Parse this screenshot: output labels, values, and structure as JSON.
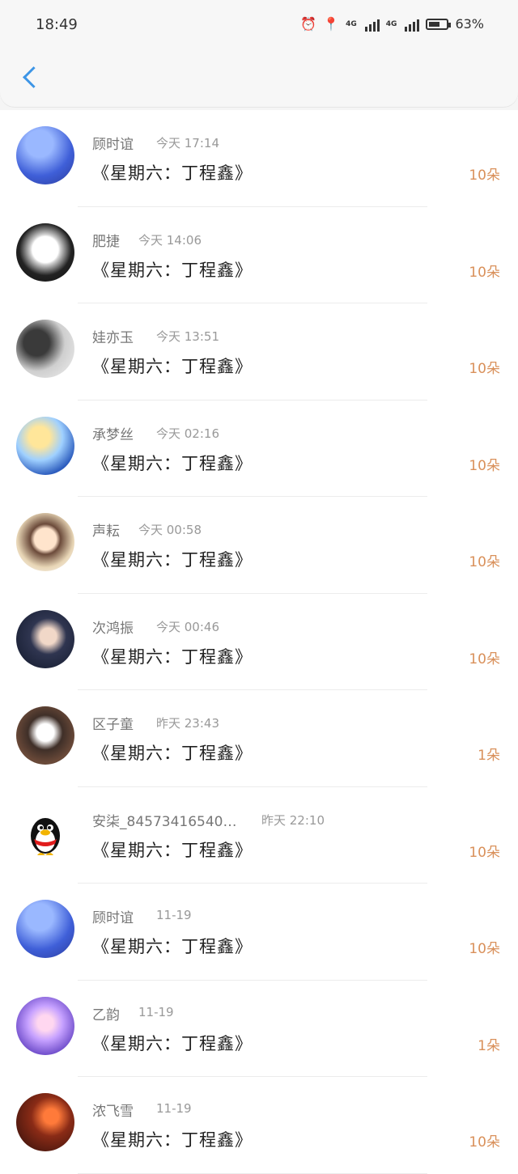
{
  "status": {
    "time": "18:49",
    "battery": "63%",
    "battery_level": 0.63,
    "net1": "4G",
    "net2": "4G"
  },
  "nav": {
    "back_icon": "chevron-left-icon"
  },
  "items": [
    {
      "name": "顾时谊",
      "time": "今天 17:14",
      "title": "《星期六：丁程鑫》",
      "count": "10朵",
      "avatar": "avatar-1"
    },
    {
      "name": "肥捷",
      "time": "今天 14:06",
      "title": "《星期六：丁程鑫》",
      "count": "10朵",
      "avatar": "avatar-2"
    },
    {
      "name": "娃亦玉",
      "time": "今天 13:51",
      "title": "《星期六：丁程鑫》",
      "count": "10朵",
      "avatar": "avatar-3"
    },
    {
      "name": "承梦丝",
      "time": "今天 02:16",
      "title": "《星期六：丁程鑫》",
      "count": "10朵",
      "avatar": "avatar-4"
    },
    {
      "name": "声耘",
      "time": "今天 00:58",
      "title": "《星期六：丁程鑫》",
      "count": "10朵",
      "avatar": "avatar-5"
    },
    {
      "name": "次鸿振",
      "time": "今天 00:46",
      "title": "《星期六：丁程鑫》",
      "count": "10朵",
      "avatar": "avatar-6"
    },
    {
      "name": "区子童",
      "time": "昨天 23:43",
      "title": "《星期六：丁程鑫》",
      "count": "1朵",
      "avatar": "avatar-7"
    },
    {
      "name": "安柒_84573416540…",
      "time": "昨天 22:10",
      "title": "《星期六：丁程鑫》",
      "count": "10朵",
      "avatar": "qq-penguin-avatar"
    },
    {
      "name": "顾时谊",
      "time": "11-19",
      "title": "《星期六：丁程鑫》",
      "count": "10朵",
      "avatar": "avatar-1"
    },
    {
      "name": "乙韵",
      "time": "11-19",
      "title": "《星期六：丁程鑫》",
      "count": "1朵",
      "avatar": "avatar-8"
    },
    {
      "name": "浓飞雪",
      "time": "11-19",
      "title": "《星期六：丁程鑫》",
      "count": "10朵",
      "avatar": "avatar-9"
    }
  ]
}
